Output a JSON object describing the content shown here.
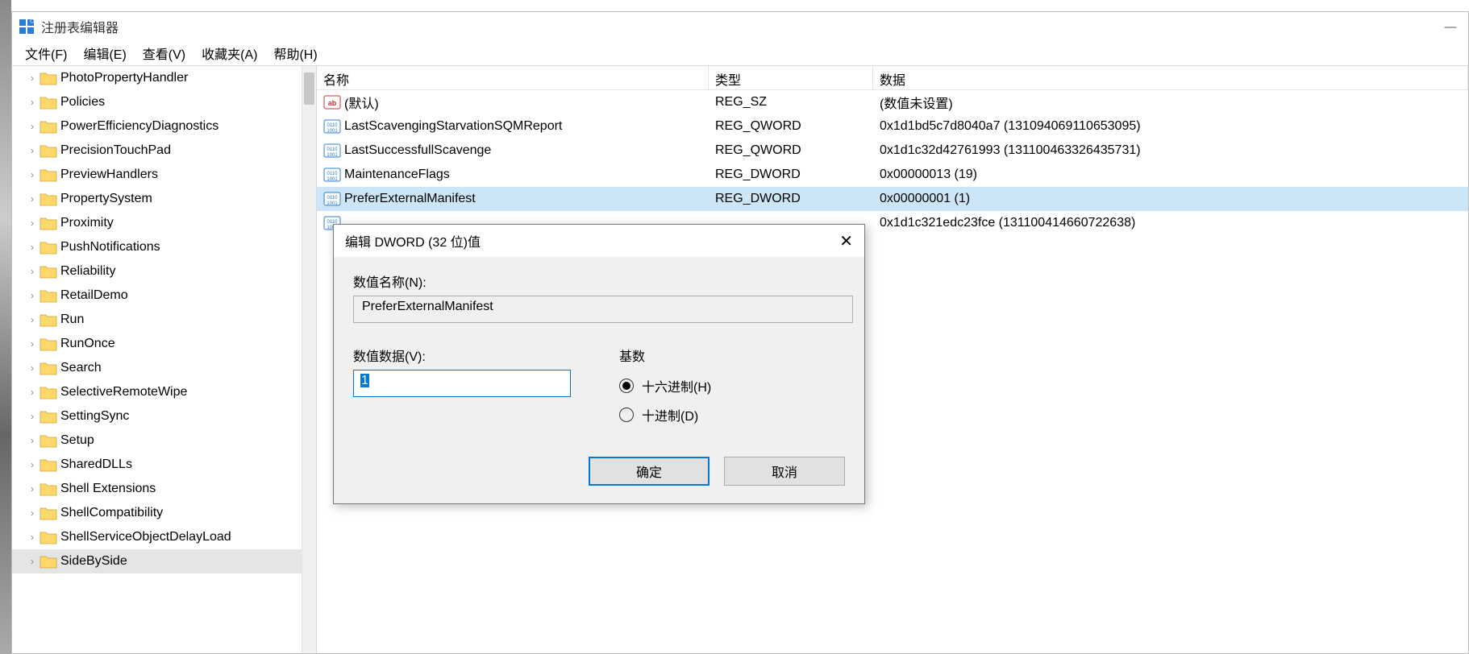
{
  "window_title": "注册表编辑器",
  "menus": {
    "file": "文件(F)",
    "edit": "编辑(E)",
    "view": "查看(V)",
    "favorites": "收藏夹(A)",
    "help": "帮助(H)"
  },
  "tree_items": [
    {
      "label": "PhotoPropertyHandler",
      "selected": false
    },
    {
      "label": "Policies",
      "selected": false
    },
    {
      "label": "PowerEfficiencyDiagnostics",
      "selected": false
    },
    {
      "label": "PrecisionTouchPad",
      "selected": false
    },
    {
      "label": "PreviewHandlers",
      "selected": false
    },
    {
      "label": "PropertySystem",
      "selected": false
    },
    {
      "label": "Proximity",
      "selected": false
    },
    {
      "label": "PushNotifications",
      "selected": false
    },
    {
      "label": "Reliability",
      "selected": false
    },
    {
      "label": "RetailDemo",
      "selected": false
    },
    {
      "label": "Run",
      "selected": false
    },
    {
      "label": "RunOnce",
      "selected": false
    },
    {
      "label": "Search",
      "selected": false
    },
    {
      "label": "SelectiveRemoteWipe",
      "selected": false
    },
    {
      "label": "SettingSync",
      "selected": false
    },
    {
      "label": "Setup",
      "selected": false
    },
    {
      "label": "SharedDLLs",
      "selected": false
    },
    {
      "label": "Shell Extensions",
      "selected": false
    },
    {
      "label": "ShellCompatibility",
      "selected": false
    },
    {
      "label": "ShellServiceObjectDelayLoad",
      "selected": false
    },
    {
      "label": "SideBySide",
      "selected": true
    }
  ],
  "list_columns": {
    "name": "名称",
    "type": "类型",
    "data": "数据"
  },
  "list_rows": [
    {
      "icon": "string",
      "name": "(默认)",
      "type": "REG_SZ",
      "data": "(数值未设置)",
      "selected": false
    },
    {
      "icon": "binary",
      "name": "LastScavengingStarvationSQMReport",
      "type": "REG_QWORD",
      "data": "0x1d1bd5c7d8040a7 (131094069110653095)",
      "selected": false
    },
    {
      "icon": "binary",
      "name": "LastSuccessfullScavenge",
      "type": "REG_QWORD",
      "data": "0x1d1c32d42761993 (131100463326435731)",
      "selected": false
    },
    {
      "icon": "binary",
      "name": "MaintenanceFlags",
      "type": "REG_DWORD",
      "data": "0x00000013 (19)",
      "selected": false
    },
    {
      "icon": "binary",
      "name": "PreferExternalManifest",
      "type": "REG_DWORD",
      "data": "0x00000001 (1)",
      "selected": true
    },
    {
      "icon": "binary",
      "name": "",
      "type": "",
      "data": "0x1d1c321edc23fce (131100414660722638)",
      "selected": false
    }
  ],
  "dialog": {
    "title": "编辑 DWORD (32 位)值",
    "name_label": "数值名称(N):",
    "name_value": "PreferExternalManifest",
    "data_label": "数值数据(V):",
    "data_value": "1",
    "base_label": "基数",
    "radio_hex": "十六进制(H)",
    "radio_dec": "十进制(D)",
    "radio_selected": "hex",
    "ok": "确定",
    "cancel": "取消"
  }
}
